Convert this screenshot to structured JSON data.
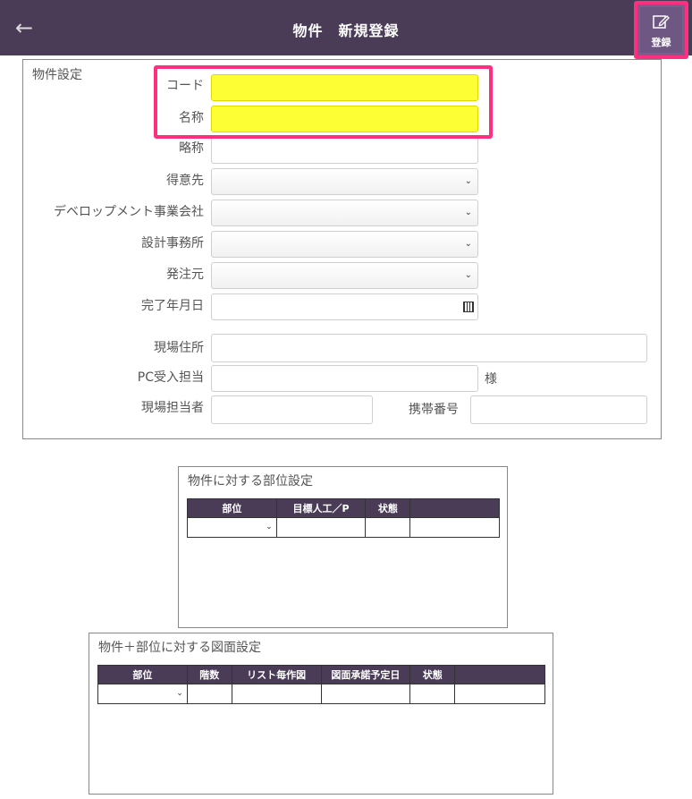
{
  "header": {
    "title": "物件　新規登録",
    "back_icon": "←",
    "register_label": "登録"
  },
  "property_settings": {
    "title": "物件設定",
    "fields": {
      "code": "コード",
      "name": "名称",
      "abbreviation": "略称",
      "customer": "得意先",
      "developer": "デベロップメント事業会社",
      "design_office": "設計事務所",
      "orderer": "発注元",
      "completion_date": "完了年月日",
      "site_address": "現場住所",
      "pc_receiver": "PC受入担当",
      "site_manager": "現場担当者",
      "mobile_number": "携帯番号"
    },
    "pc_suffix": "様"
  },
  "part_settings": {
    "title": "物件に対する部位設定",
    "columns": [
      "部位",
      "目標人工／P",
      "状態",
      ""
    ]
  },
  "drawing_settings": {
    "title": "物件＋部位に対する図面設定",
    "columns": [
      "部位",
      "階数",
      "リスト毎作図",
      "図面承諾予定日",
      "状態",
      ""
    ]
  },
  "colors": {
    "header_bg": "#4a3c57",
    "highlight": "#ff2e7e",
    "required_field": "#fefe35"
  }
}
